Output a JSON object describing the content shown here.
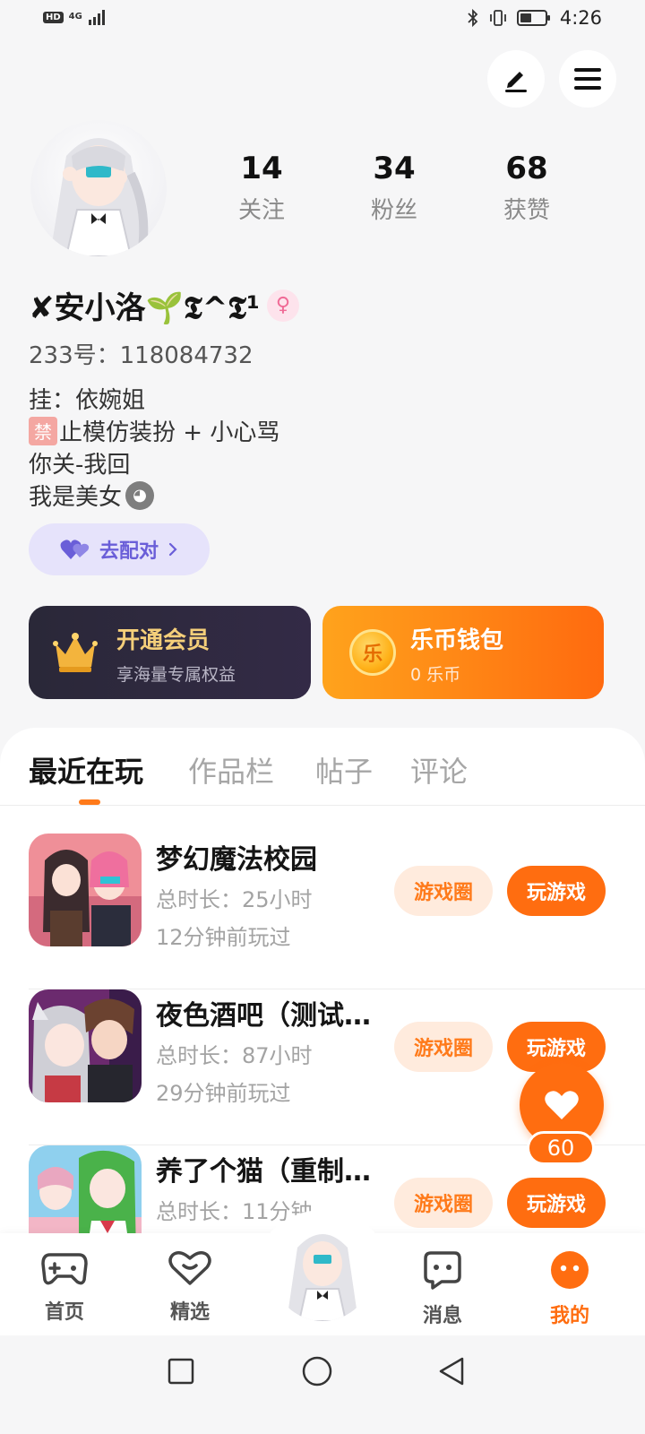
{
  "status_bar": {
    "hd": "HD",
    "network": "4G",
    "time": "4:26"
  },
  "profile": {
    "username": "✘安小洛🌱𝕿^𝕿¹",
    "gender_symbol": "♀",
    "uid": "233号：118084732",
    "bio": [
      "挂：依婉姐",
      "止模仿装扮 + 小心骂",
      "你关-我回",
      "我是美女"
    ],
    "ban_char": "禁",
    "match_label": "去配对"
  },
  "stats": [
    {
      "value": "14",
      "label": "关注"
    },
    {
      "value": "34",
      "label": "粉丝"
    },
    {
      "value": "68",
      "label": "获赞"
    }
  ],
  "vip": {
    "title": "开通会员",
    "subtitle": "享海量专属权益"
  },
  "wallet": {
    "title": "乐币钱包",
    "subtitle": "0 乐币",
    "coin_char": "乐"
  },
  "tabs": [
    "最近在玩",
    "作品栏",
    "帖子",
    "评论"
  ],
  "games": [
    {
      "title": "梦幻魔法校园",
      "total_time": "总时长：25小时",
      "last_played": "12分钟前玩过",
      "circle_label": "游戏圈",
      "play_label": "玩游戏"
    },
    {
      "title": "夜色酒吧（测试…",
      "total_time": "总时长：87小时",
      "last_played": "29分钟前玩过",
      "circle_label": "游戏圈",
      "play_label": "玩游戏"
    },
    {
      "title": "养了个猫（重制…",
      "total_time": "总时长：11分钟",
      "last_played": "",
      "circle_label": "游戏圈",
      "play_label": "玩游戏"
    }
  ],
  "like_count": "60",
  "bottom_nav": {
    "home": "首页",
    "featured": "精选",
    "messages": "消息",
    "me": "我的"
  },
  "colors": {
    "accent": "#ff6d10",
    "match_bg": "#e6e3fb",
    "vip_gold": "#f5cf7a"
  }
}
